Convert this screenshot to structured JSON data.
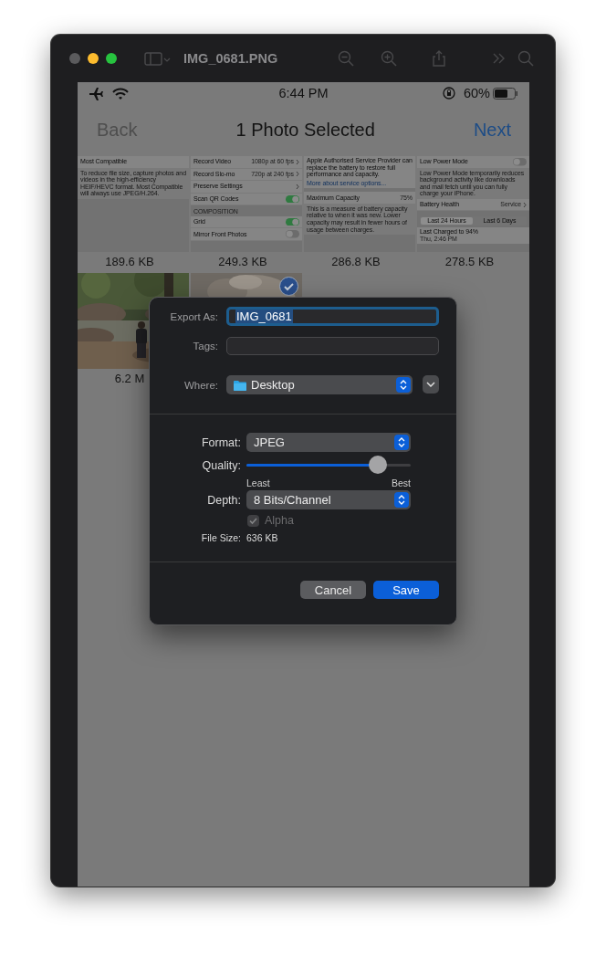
{
  "window": {
    "title": "IMG_0681.PNG"
  },
  "ios_status_bar": {
    "time": "6:44 PM",
    "battery": "60%"
  },
  "nav_bar": {
    "back": "Back",
    "title": "1 Photo Selected",
    "next": "Next"
  },
  "thumbnails": [
    {
      "kind": "screen",
      "selected": false,
      "size": "189.6 KB",
      "items": [
        {
          "kind": "row",
          "label": "Most Compatible",
          "chevron": false
        },
        {
          "kind": "note",
          "text": "To reduce file size, capture photos and videos in the high-efficiency HEIF/HEVC format. Most Compatible will always use JPEG/H.264."
        }
      ]
    },
    {
      "kind": "screen",
      "selected": false,
      "size": "249.3 KB",
      "items": [
        {
          "kind": "row",
          "label": "Record Video",
          "value": "1080p at 60 fps",
          "chevron": true
        },
        {
          "kind": "row",
          "label": "Record Slo-mo",
          "value": "720p at 240 fps",
          "chevron": true
        },
        {
          "kind": "row",
          "label": "Preserve Settings",
          "chevron": true
        },
        {
          "kind": "toggle",
          "label": "Scan QR Codes",
          "on": true
        },
        {
          "kind": "header",
          "text": "COMPOSITION"
        },
        {
          "kind": "toggle",
          "label": "Grid",
          "on": true
        },
        {
          "kind": "toggle",
          "label": "Mirror Front Photos",
          "on": false
        }
      ]
    },
    {
      "kind": "screen",
      "selected": false,
      "size": "286.8 KB",
      "items": [
        {
          "kind": "paragraph",
          "text": "Apple Authorised Service Provider can replace the battery to restore full performance and capacity."
        },
        {
          "kind": "link",
          "text": "More about service options..."
        },
        {
          "kind": "gap"
        },
        {
          "kind": "row",
          "label": "Maximum Capacity",
          "value": "75%",
          "chevron": false
        },
        {
          "kind": "note",
          "text": "This is a measure of battery capacity relative to when it was new. Lower capacity may result in fewer hours of usage between charges."
        }
      ]
    },
    {
      "kind": "screen",
      "selected": false,
      "size": "278.5 KB",
      "items": [
        {
          "kind": "toggle",
          "label": "Low Power Mode",
          "on": false
        },
        {
          "kind": "note",
          "text": "Low Power Mode temporarily reduces background activity like downloads and mail fetch until you can fully charge your iPhone."
        },
        {
          "kind": "row",
          "label": "Battery Health",
          "value": "Service",
          "chevron": true
        },
        {
          "kind": "gap"
        },
        {
          "kind": "segmented",
          "options": [
            {
              "label": "Last 24 Hours",
              "selected": true
            },
            {
              "label": "Last 6 Days",
              "selected": false
            }
          ]
        },
        {
          "kind": "detail",
          "label": "Last Charged to 94%",
          "sub": "Thu, 2:46 PM"
        }
      ]
    },
    {
      "kind": "picture",
      "selected": false,
      "size": "6.2 M"
    },
    {
      "kind": "picture",
      "selected": true
    }
  ],
  "export_dialog": {
    "export_as_label": "Export As:",
    "export_as": "IMG_0681",
    "tags_label": "Tags:",
    "where_label": "Where:",
    "where": "Desktop",
    "format_label": "Format:",
    "format": "JPEG",
    "quality_label": "Quality:",
    "quality": {
      "level": 0.8
    },
    "quality_min": "Least",
    "quality_max": "Best",
    "depth_label": "Depth:",
    "depth": "8 Bits/Channel",
    "alpha": {
      "label": "Alpha",
      "checked": true,
      "disabled": true
    },
    "file_size_label": "File Size:",
    "file_size": "636 KB",
    "buttons": [
      {
        "kind": "cancel",
        "label": "Cancel"
      },
      {
        "kind": "default",
        "label": "Save"
      }
    ]
  }
}
